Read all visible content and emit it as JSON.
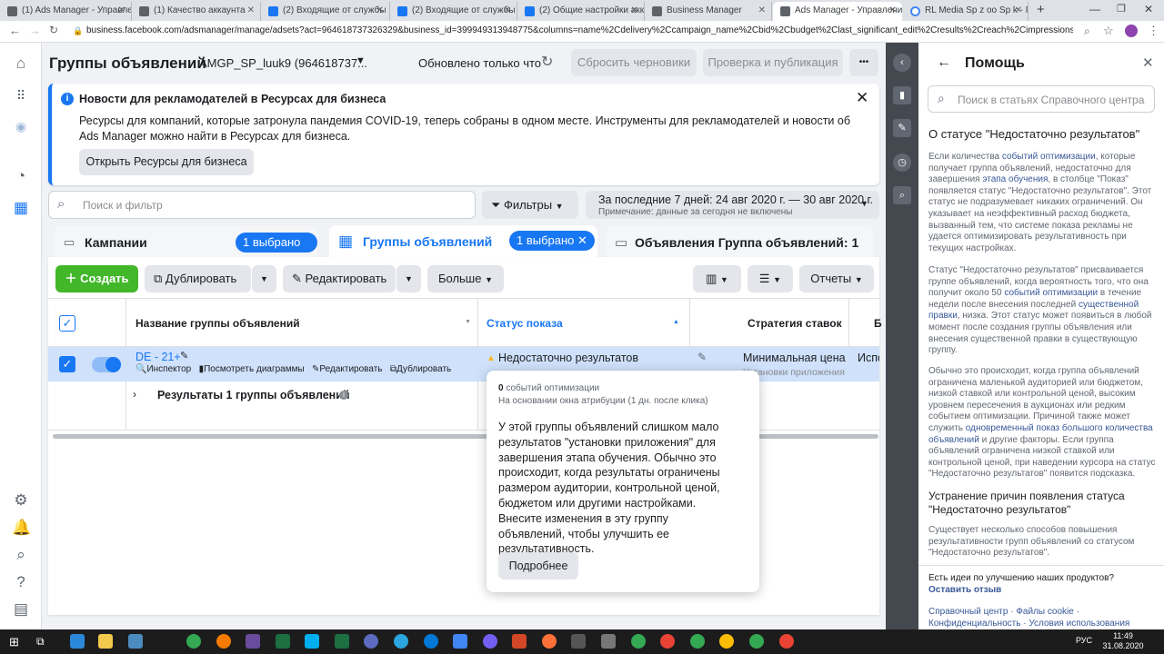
{
  "browser": {
    "tabs": [
      "(1) Ads Manager - Управле",
      "(1) Качество аккаунта",
      "(2) Входящие от службы п",
      "(2) Входящие от службы п",
      "(2) Общие настройки акка",
      "Business Manager",
      "Ads Manager - Управлени",
      "RL Media Sp z oo Sp k - По"
    ],
    "url": "business.facebook.com/adsmanager/manage/adsets?act=964618737326329&business_id=399949313948775&columns=name%2Cdelivery%2Ccampaign_name%2Cbid%2Cbudget%2Clast_significant_edit%2Cresults%2Creach%2Cimpressions%2Ccost_per_result%..."
  },
  "header": {
    "title": "Группы объявлений",
    "account": "AMGP_SP_luuk9 (964618737...",
    "updated": "Обновлено только что",
    "discard": "Сбросить черновики",
    "review": "Проверка и публикация",
    "more": "•••"
  },
  "notice": {
    "title": "Новости для рекламодателей в Ресурсах для бизнеса",
    "body": "Ресурсы для компаний, которые затронула пандемия COVID-19, теперь собраны в одном месте. Инструменты для рекламодателей и новости об Ads Manager можно найти в Ресурсах для бизнеса.",
    "button": "Открыть Ресурсы для бизнеса"
  },
  "search": {
    "placeholder": "Поиск и фильтр"
  },
  "filters": "Фильтры",
  "date": {
    "range": "За последние 7 дней: 24 авг 2020 г. — 30 авг 2020 г.",
    "note": "Примечание: данные за сегодня не включены"
  },
  "tabs": {
    "campaigns": "Кампании",
    "campaigns_chip": "1 выбрано",
    "adsets": "Группы объявлений",
    "adsets_chip": "1 выбрано",
    "ads": "Объявления Группа объявлений: 1"
  },
  "toolbar": {
    "create": "Создать",
    "duplicate": "Дублировать",
    "edit": "Редактировать",
    "more": "Больше",
    "reports": "Отчеты"
  },
  "table": {
    "col_name": "Название группы объявлений",
    "col_status": "Статус показа",
    "col_bid": "Стратегия ставок",
    "col_extra": "Б",
    "row": {
      "name": "DE - 21+",
      "inspector": "Инспектор",
      "charts": "Посмотреть диаграммы",
      "edit": "Редактировать",
      "duplicate": "Дублировать",
      "status": "Недостаточно результатов",
      "bid": "Минимальная цена",
      "bid_sub": "Установки приложения",
      "extra": "Испо"
    },
    "results": "Результаты 1 группы объявлений"
  },
  "popover": {
    "count": "0",
    "count_label": "событий оптимизации",
    "attribution": "На основании окна атрибуции (1 дн. после клика)",
    "body": "У этой группы объявлений слишком мало результатов \"установки приложения\" для завершения этапа обучения. Обычно это происходит, когда результаты ограничены размером аудитории, контрольной ценой, бюджетом или другими настройками. Внесите изменения в эту группу объявлений, чтобы улучшить ее результативность.",
    "button": "Подробнее"
  },
  "help": {
    "title": "Помощь",
    "search_placeholder": "Поиск в статьях Справочного центра",
    "heading": "О статусе \"Недостаточно результатов\"",
    "p1a": "Если количества ",
    "p1l1": "событий оптимизации",
    "p1b": ", которые получает группа объявлений, недостаточно для завершения ",
    "p1l2": "этапа обучения",
    "p1c": ", в столбце \"Показ\" появляется статус \"Недостаточно результатов\". Этот статус не подразумевает никаких ограничений. Он указывает на неэффективный расход бюджета, вызванный тем, что системе показа рекламы не удается оптимизировать результативность при текущих настройках.",
    "p2a": "Статус \"Недостаточно результатов\" присваивается группе объявлений, когда вероятность того, что она получит около 50 ",
    "p2l1": "событий оптимизации",
    "p2b": " в течение недели после внесения последней ",
    "p2l2": "существенной правки",
    "p2c": ", низка. Этот статус может появиться в любой момент после создания группы объявления или внесения существенной правки в существующую группу.",
    "p3a": "Обычно это происходит, когда группа объявлений ограничена маленькой аудиторией или бюджетом, низкой ставкой или контрольной ценой, высоким уровнем пересечения в аукционах или редким событием оптимизации. Причиной также может служить ",
    "p3l1": "одновременный показ большого количества объявлений",
    "p3b": " и другие факторы. Если группа объявлений ограничена низкой ставкой или контрольной ценой, при наведении курсора на статус \"Недостаточно результатов\" появится подсказка.",
    "heading2": "Устранение причин появления статуса \"Недостаточно результатов\"",
    "p4": "Существует несколько способов повышения результативности групп объявлений со статусом \"Недостаточно результатов\".",
    "feedback_q": "Есть идеи по улучшению наших продуктов?",
    "feedback_link": "Оставить отзыв",
    "footer1": "Справочный центр",
    "footer2": "Файлы cookie",
    "footer3": "Конфиденциальность",
    "footer4": "Условия использования",
    "sep": " · "
  },
  "taskbar": {
    "time": "11:49",
    "date": "31.08.2020",
    "lang": "РУС"
  },
  "colors": {
    "brand": "#1877f2",
    "green": "#42b72a",
    "warning": "#f7b928"
  }
}
